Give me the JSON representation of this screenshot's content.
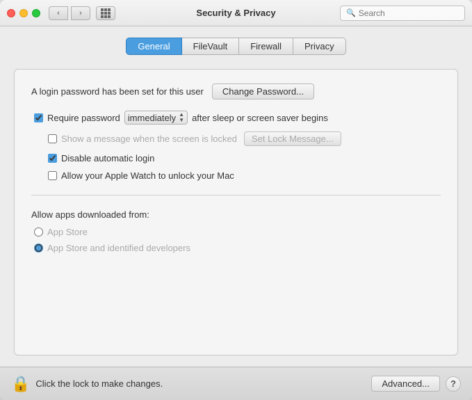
{
  "titlebar": {
    "title": "Security & Privacy",
    "search_placeholder": "Search"
  },
  "tabs": [
    {
      "label": "General",
      "active": true
    },
    {
      "label": "FileVault",
      "active": false
    },
    {
      "label": "Firewall",
      "active": false
    },
    {
      "label": "Privacy",
      "active": false
    }
  ],
  "panel": {
    "login_label": "A login password has been set for this user",
    "change_password_button": "Change Password...",
    "require_password": {
      "checkbox_checked": true,
      "label_before": "Require password",
      "dropdown_value": "immediately",
      "label_after": "after sleep or screen saver begins"
    },
    "show_message": {
      "checkbox_checked": false,
      "label": "Show a message when the screen is locked",
      "set_lock_button": "Set Lock Message..."
    },
    "disable_auto_login": {
      "checkbox_checked": true,
      "label": "Disable automatic login"
    },
    "apple_watch": {
      "checkbox_checked": false,
      "label": "Allow your Apple Watch to unlock your Mac"
    },
    "allow_apps": {
      "label": "Allow apps downloaded from:",
      "options": [
        {
          "label": "App Store",
          "selected": false
        },
        {
          "label": "App Store and identified developers",
          "selected": true
        }
      ]
    }
  },
  "bottom_bar": {
    "lock_label": "Click the lock to make changes.",
    "advanced_button": "Advanced...",
    "help_button": "?"
  }
}
